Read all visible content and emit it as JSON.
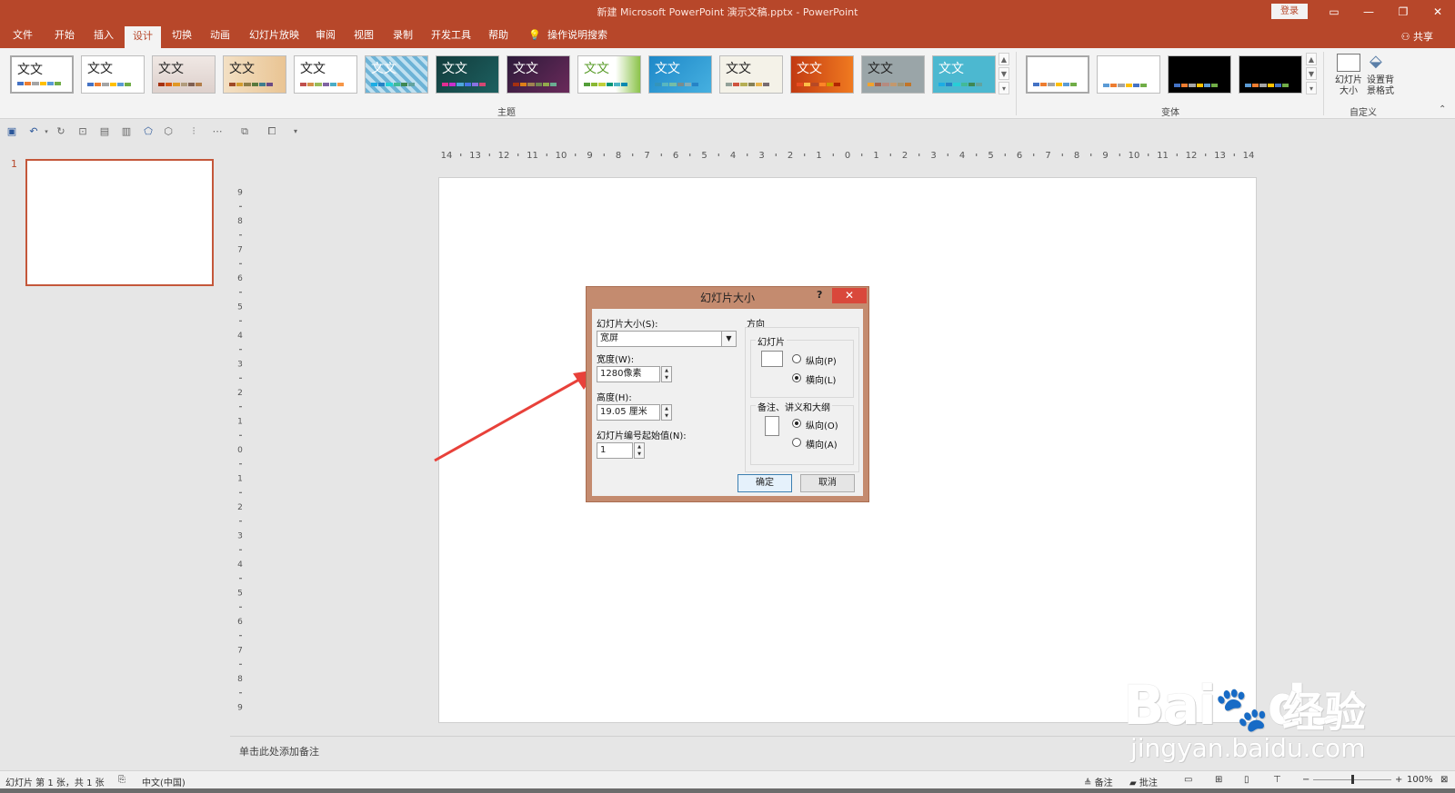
{
  "window": {
    "title": "新建 Microsoft PowerPoint 演示文稿.pptx  -  PowerPoint",
    "login_label": "登录"
  },
  "menu": {
    "tabs": [
      "文件",
      "开始",
      "插入",
      "设计",
      "切换",
      "动画",
      "幻灯片放映",
      "审阅",
      "视图",
      "录制",
      "开发工具",
      "帮助"
    ],
    "active_tab": "设计",
    "search_label": "操作说明搜索",
    "share_label": "共享"
  },
  "ribbon": {
    "themes_label": "主题",
    "variants_label": "变体",
    "customize_label": "自定义",
    "theme_text": "文文",
    "slide_size_label_1": "幻灯片",
    "slide_size_label_2": "大小",
    "format_bg_label_1": "设置背",
    "format_bg_label_2": "景格式"
  },
  "slides_pane": {
    "slide_number": "1"
  },
  "notes": {
    "placeholder": "单击此处添加备注"
  },
  "statusbar": {
    "slide_info": "幻灯片 第 1 张，共 1 张",
    "language": "中文(中国)",
    "notes_label": "备注",
    "comments_label": "批注",
    "zoom": "100%"
  },
  "dialog": {
    "title": "幻灯片大小",
    "help": "?",
    "close": "✕",
    "slide_size_label": "幻灯片大小(S):",
    "slide_size_value": "宽屏",
    "width_label": "宽度(W):",
    "width_value": "1280像素",
    "height_label": "高度(H):",
    "height_value": "19.05 厘米",
    "start_number_label": "幻灯片编号起始值(N):",
    "start_number_value": "1",
    "orientation_label": "方向",
    "slides_group_label": "幻灯片",
    "slides_portrait": "纵向(P)",
    "slides_landscape": "横向(L)",
    "notes_group_label": "备注、讲义和大纲",
    "notes_portrait": "纵向(O)",
    "notes_landscape": "横向(A)",
    "ok_label": "确定",
    "cancel_label": "取消"
  },
  "watermark": {
    "brand": "Bai",
    "brand2": "du",
    "cn": "经验",
    "url": "jingyan.baidu.com"
  },
  "colors": {
    "accent": "#b7472a",
    "arrow": "#e8413a"
  }
}
